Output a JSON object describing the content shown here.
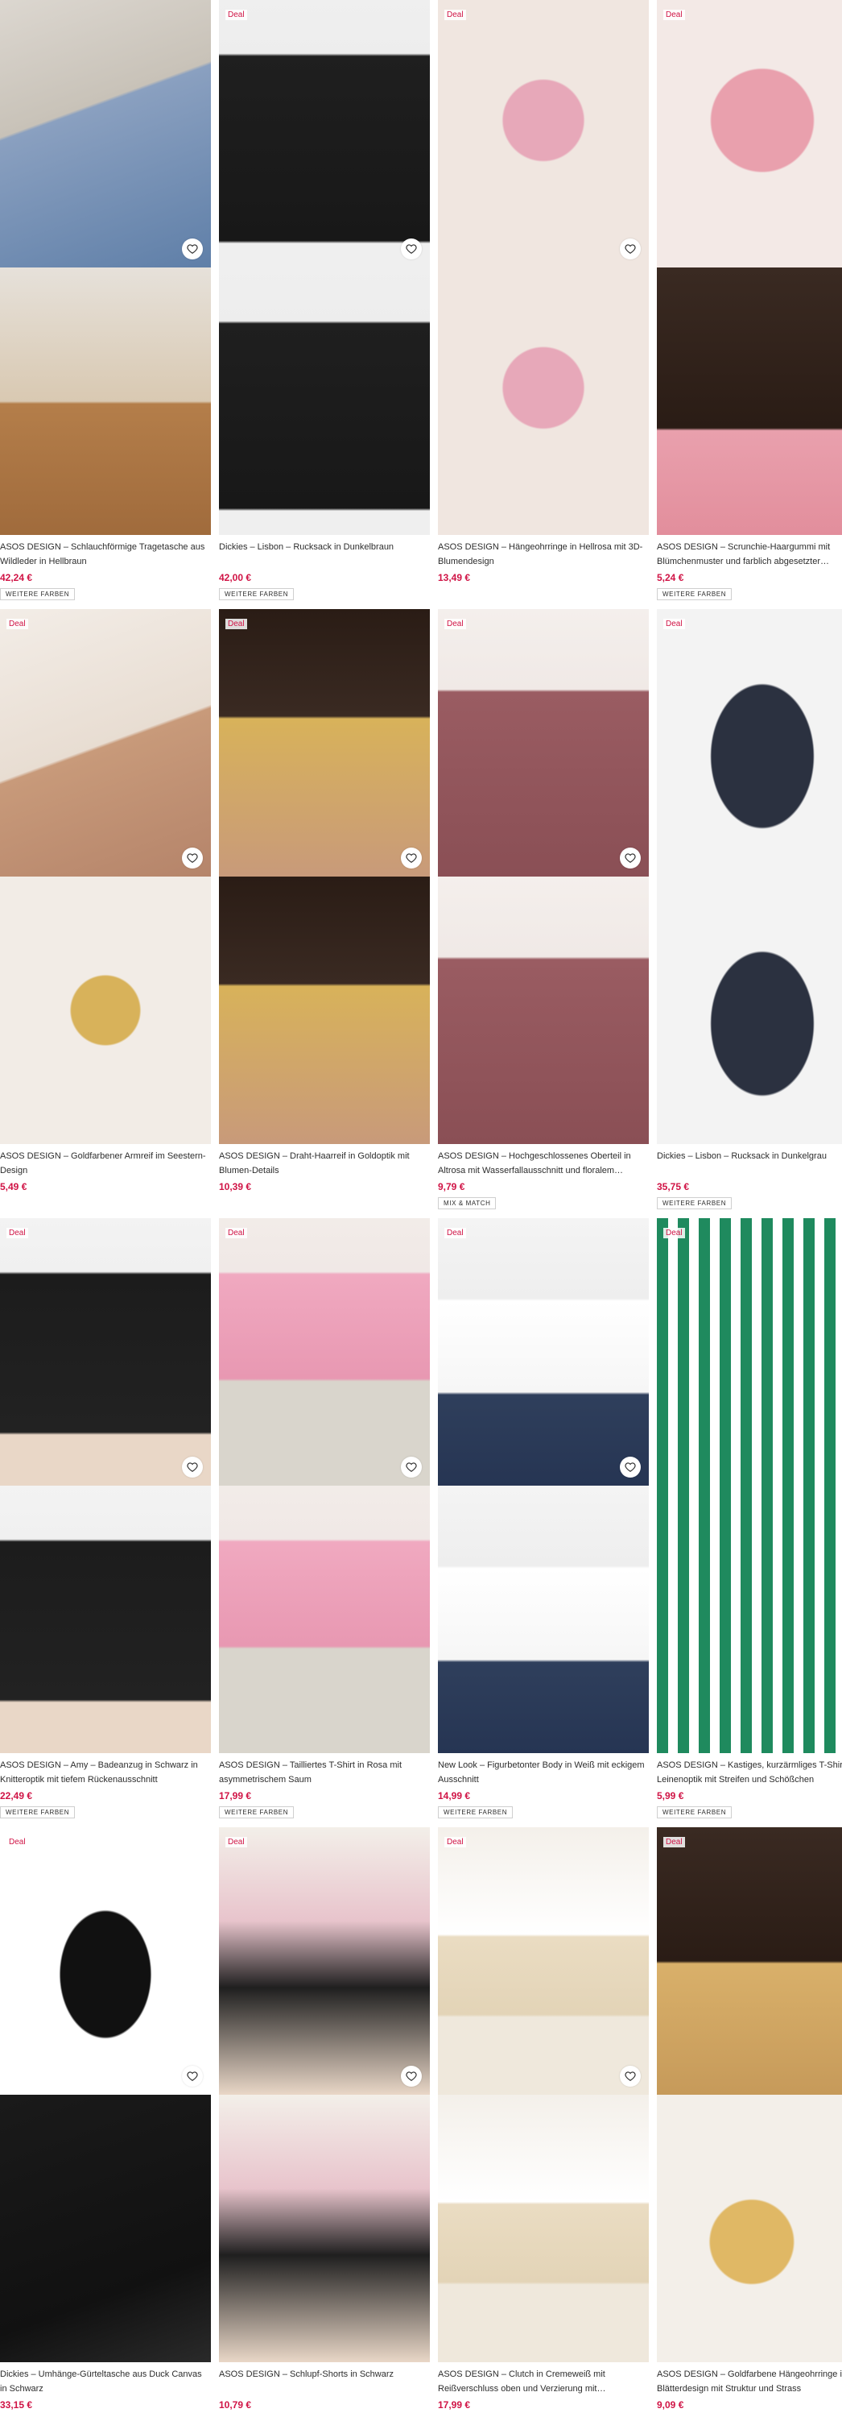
{
  "ui": {
    "deal_label": "Deal",
    "more_colors_label": "WEITERE FARBEN",
    "mix_match_label": "MIX & MATCH"
  },
  "colors": {
    "price": "#d01345",
    "deal": "#d01345"
  },
  "products": [
    {
      "title": "ASOS DESIGN – Schlauchförmige Tragetasche aus Wildleder in Hellbraun",
      "price": "42,24 €",
      "deal": false,
      "chip": "WEITERE FARBEN"
    },
    {
      "title": "Dickies – Lisbon – Rucksack in Dunkelbraun",
      "price": "42,00 €",
      "deal": true,
      "chip": "WEITERE FARBEN"
    },
    {
      "title": "ASOS DESIGN – Hängeohrringe in Hellrosa mit 3D-Blumendesign",
      "price": "13,49 €",
      "deal": true,
      "chip": ""
    },
    {
      "title": "ASOS DESIGN – Scrunchie-Haargummi mit Blümchenmuster und farblich abgesetzter…",
      "price": "5,24 €",
      "deal": true,
      "chip": "WEITERE FARBEN"
    },
    {
      "title": "ASOS DESIGN – Goldfarbener Armreif im Seestern-Design",
      "price": "5,49 €",
      "deal": true,
      "chip": ""
    },
    {
      "title": "ASOS DESIGN – Draht-Haarreif in Goldoptik mit Blumen-Details",
      "price": "10,39 €",
      "deal": true,
      "chip": ""
    },
    {
      "title": "ASOS DESIGN – Hochgeschlossenes Oberteil in Altrosa mit Wasserfallausschnitt und floralem…",
      "price": "9,79 €",
      "deal": true,
      "chip": "MIX & MATCH"
    },
    {
      "title": "Dickies – Lisbon – Rucksack in Dunkelgrau",
      "price": "35,75 €",
      "deal": true,
      "chip": "WEITERE FARBEN"
    },
    {
      "title": "ASOS DESIGN – Amy – Badeanzug in Schwarz in Knitteroptik mit tiefem Rückenausschnitt",
      "price": "22,49 €",
      "deal": true,
      "chip": "WEITERE FARBEN"
    },
    {
      "title": "ASOS DESIGN – Tailliertes T-Shirt in Rosa mit asymmetrischem Saum",
      "price": "17,99 €",
      "deal": true,
      "chip": "WEITERE FARBEN"
    },
    {
      "title": "New Look – Figurbetonter Body in Weiß mit eckigem Ausschnitt",
      "price": "14,99 €",
      "deal": true,
      "chip": "WEITERE FARBEN"
    },
    {
      "title": "ASOS DESIGN – Kastiges, kurzärmliges T-Shirt in Leinenoptik mit Streifen und Schößchen",
      "price": "5,99 €",
      "deal": true,
      "chip": "WEITERE FARBEN"
    },
    {
      "title": "Dickies – Umhänge-Gürteltasche aus Duck Canvas in Schwarz",
      "price": "33,15 €",
      "deal": true,
      "chip": ""
    },
    {
      "title": "ASOS DESIGN – Schlupf-Shorts in Schwarz",
      "price": "10,79 €",
      "deal": true,
      "chip": ""
    },
    {
      "title": "ASOS DESIGN – Clutch in Cremeweiß mit Reißverschluss oben und Verzierung mit…",
      "price": "17,99 €",
      "deal": true,
      "chip": ""
    },
    {
      "title": "ASOS DESIGN – Goldfarbene Hängeohrringe im Blätterdesign mit Struktur und Strass",
      "price": "9,09 €",
      "deal": true,
      "chip": ""
    }
  ]
}
